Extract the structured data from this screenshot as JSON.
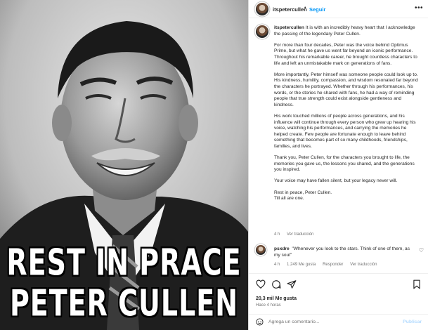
{
  "image": {
    "caption_line1": "REST IN PRACE",
    "caption_line2": "PETER CULLEN"
  },
  "header": {
    "username": "itspetercullen",
    "separator": "•",
    "follow_label": "Seguir",
    "more_icon": "more-horizontal-icon"
  },
  "post": {
    "username": "itspetercullen",
    "paragraphs": [
      "It is with an incredibly heavy heart that I acknowledge the passing of the legendary Peter Cullen.",
      "For more than four decades, Peter was the voice behind Optimus Prime, but what he gave us went far beyond an iconic performance. Throughout his remarkable career, he brought countless characters to life and left an unmistakable mark on generations of fans.",
      "More importantly, Peter himself was someone people could look up to. His kindness, humility, compassion, and wisdom resonated far beyond the characters he portrayed. Whether through his performances, his words, or the stories he shared with fans, he had a way of reminding people that true strength could exist alongside gentleness and kindness.",
      "His work touched millions of people across generations, and his influence will continue through every person who grew up hearing his voice, watching his performances, and carrying the memories he helped create. Few people are fortunate enough to leave behind something that becomes part of so many childhoods, friendships, families, and lives.",
      "Thank you, Peter Cullen, for the characters you brought to life, the memories you gave us, the lessons you shared, and the generations you inspired.",
      "Your voice may have fallen silent, but your legacy never will."
    ],
    "closing_line1": "Rest in peace, Peter Cullen.",
    "closing_line2": "Till all are one.",
    "meta": {
      "age": "4 h",
      "translate": "Ver traducción"
    }
  },
  "comment": {
    "username": "psxdre",
    "text": "\"Whenever you look to the stars. Think of one of them, as my soul\"",
    "meta": {
      "age": "4 h",
      "likes": "1.249 Me gusta",
      "reply": "Responder",
      "translate": "Ver traducción"
    }
  },
  "actions": {
    "icons": [
      "heart-icon",
      "comment-icon",
      "share-icon",
      "save-icon"
    ]
  },
  "stats": {
    "likes": "20,3 mil Me gusta",
    "time": "Hace 4 horas"
  },
  "compose": {
    "placeholder": "Agrega un comentario...",
    "publish": "Publicar"
  }
}
